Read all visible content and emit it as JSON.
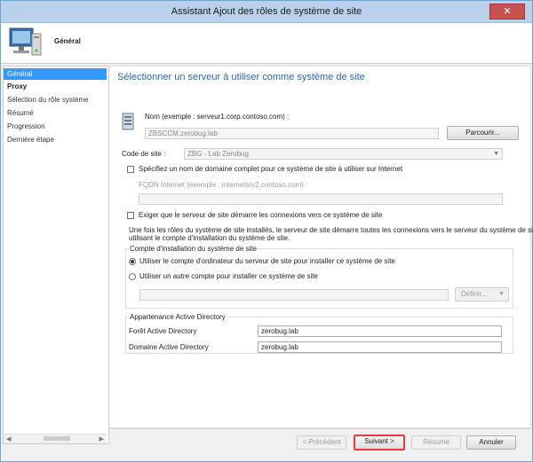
{
  "window": {
    "title": "Assistant Ajout des rôles de système de site",
    "close_glyph": "✕"
  },
  "header": {
    "page_title": "Général",
    "icon": "computer-icon"
  },
  "nav": {
    "items": [
      {
        "label": "Général",
        "active": true
      },
      {
        "label": "Proxy"
      },
      {
        "label": "Sélection du rôle système"
      },
      {
        "label": "Résumé"
      },
      {
        "label": "Progression"
      },
      {
        "label": "Dernière étape"
      }
    ],
    "scroll_left": "◀",
    "scroll_right": "▶"
  },
  "main": {
    "heading": "Sélectionner un serveur à utiliser comme système de site",
    "server_icon": "server-icon",
    "name_label": "Nom (exemple : serveur1.corp.contoso.com) :",
    "name_value": "ZBSCCM.zerobug.lab",
    "browse_label": "Parcourir...",
    "site_code_label": "Code de site :",
    "site_code_value": "ZBG - Lab Zerobug",
    "fqdn_checkbox_label": "Spécifiez un nom de domaine complet pour ce système de site à utiliser sur Internet",
    "fqdn_label": "FQDN Internet (exemple : internetsrv2.contoso.com) :",
    "fqdn_value": "",
    "require_checkbox_label": "Exiger que le serveur de site démarre les connexions vers ce système de site",
    "info_text_1": "Une fois les rôles du système de site installés, le serveur de site démarre toutes les connexions vers le serveur du système de site en",
    "info_text_2": "utilisant le compte d'installation du système de site.",
    "install_account_group": "Compte d'installation du système de site",
    "radio_computer_label": "Utiliser le compte d'ordinateur du serveur de site pour installer ce système de site",
    "radio_other_label": "Utiliser un autre compte pour installer ce système de site",
    "other_account_value": "",
    "define_label": "Définir...",
    "ad_group": "Appartenance Active Directory",
    "forest_label": "Forêt Active Directory",
    "forest_value": "zerobug.lab",
    "domain_label": "Domaine Active Directory",
    "domain_value": "zerobug.lab"
  },
  "footer": {
    "previous_label": "< Précédent",
    "next_label": "Suivant >",
    "summary_label": "Résumé",
    "cancel_label": "Annuler"
  },
  "colors": {
    "heading": "#2a6aad",
    "nav_active": "#3399ff",
    "next_highlight": "#e23d3d"
  }
}
